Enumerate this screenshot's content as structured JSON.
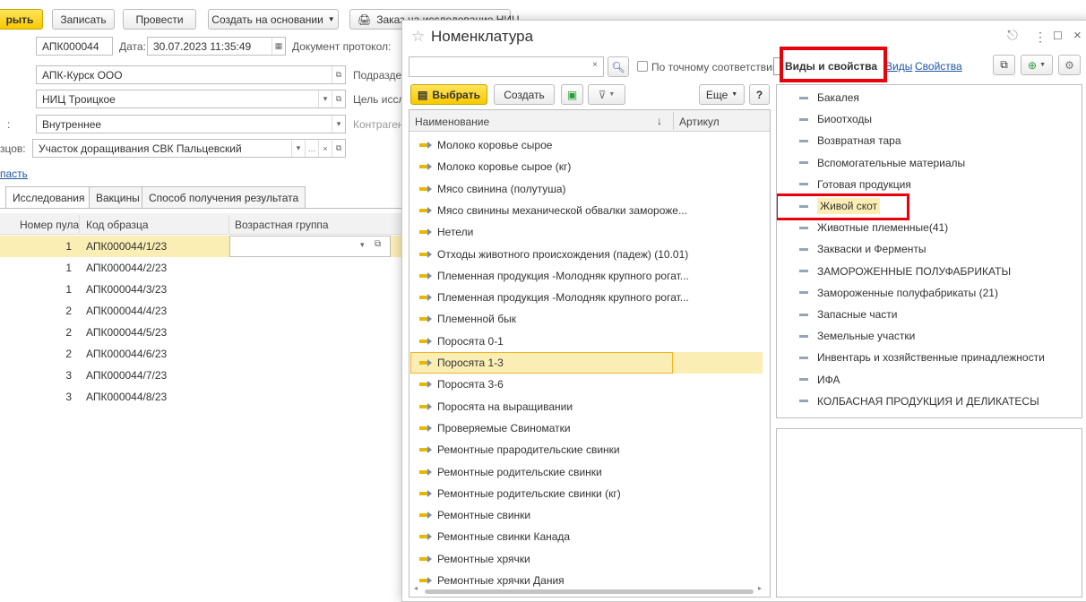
{
  "bg_form": {
    "toolbar": {
      "close_label": "рыть",
      "write_label": "Записать",
      "post_label": "Провести",
      "create_based_label": "Создать на основании",
      "order_label": "Заказ на исследование НИЦ"
    },
    "number_value": "АПК000044",
    "date_label": "Дата:",
    "date_value": "30.07.2023 11:35:49",
    "protocol_label": "Документ протокол:",
    "org_value": "АПК-Курск ООО",
    "subdiv_label": "Подразде",
    "nic_value": "НИЦ Троицкое",
    "purpose_label": "Цель иссл",
    "type_label": ":",
    "type_value": "Внутреннее",
    "contragent_label": "Контрагент",
    "samples_label": "зцов:",
    "samples_value": "Участок доращивания СВК Пальцевский",
    "region_link": "пасть",
    "tabs": [
      "Исследования",
      "Вакцины",
      "Способ получения результата"
    ],
    "columns": [
      "Номер пула",
      "Код образца",
      "Возрастная группа"
    ],
    "rows": [
      {
        "pool": "1",
        "code": "АПК000044/1/23"
      },
      {
        "pool": "1",
        "code": "АПК000044/2/23"
      },
      {
        "pool": "1",
        "code": "АПК000044/3/23"
      },
      {
        "pool": "2",
        "code": "АПК000044/4/23"
      },
      {
        "pool": "2",
        "code": "АПК000044/5/23"
      },
      {
        "pool": "2",
        "code": "АПК000044/6/23"
      },
      {
        "pool": "3",
        "code": "АПК000044/7/23"
      },
      {
        "pool": "3",
        "code": "АПК000044/8/23"
      }
    ]
  },
  "dialog": {
    "title": "Номенклатура",
    "search_value": "",
    "exact_match_label": "По точному соответствию",
    "kinds_label": "Виды и свойства",
    "kinds_link": "Виды",
    "props_link": "Свойства",
    "select_label": "Выбрать",
    "create_label": "Создать",
    "more_label": "Еще",
    "help_label": "?",
    "col_name": "Наименование",
    "col_sort": "↓",
    "col_article": "Артикул",
    "items": [
      "Молоко коровье сырое",
      "Молоко коровье сырое (кг)",
      "Мясо свинина (полутуша)",
      "Мясо свинины механической обвалки замороже...",
      "Нетели",
      "Отходы животного происхождения (падеж) (10.01)",
      "Племенная продукция -Молодняк крупного рогат...",
      "Племенная продукция -Молодняк крупного рогат...",
      "Племенной бык",
      "Поросята 0-1",
      "Поросята 1-3",
      "Поросята 3-6",
      "Поросята на выращивании",
      "Проверяемые Свиноматки",
      "Ремонтные прародительские свинки",
      "Ремонтные родительские свинки",
      "Ремонтные родительские свинки (кг)",
      "Ремонтные свинки",
      "Ремонтные свинки Канада",
      "Ремонтные хрячки",
      "Ремонтные хрячки Дания"
    ],
    "selected_index": 10,
    "kinds": [
      "Бакалея",
      "Биоотходы",
      "Возвратная тара",
      "Вспомогательные материалы",
      "Готовая продукция",
      "Живой скот",
      "Животные племенные(41)",
      "Закваски и Ферменты",
      "ЗАМОРОЖЕННЫЕ ПОЛУФАБРИКАТЫ",
      "Замороженные полуфабрикаты (21)",
      "Запасные части",
      "Земельные участки",
      "Инвентарь и хозяйственные принадлежности",
      "ИФА",
      "КОЛБАСНАЯ ПРОДУКЦИЯ И ДЕЛИКАТЕСЫ"
    ],
    "selected_kind_index": 5,
    "accent_red": "#e8000b",
    "selected_bg": "#fbeeb4"
  }
}
